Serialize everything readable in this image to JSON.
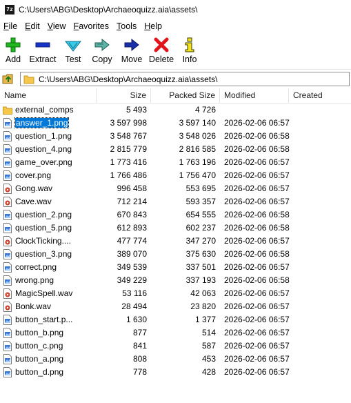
{
  "window": {
    "app_icon_text": "7z",
    "title": "C:\\Users\\ABG\\Desktop\\Archaeoquizz.aia\\assets\\"
  },
  "menu": [
    {
      "key": "F",
      "rest": "ile"
    },
    {
      "key": "E",
      "rest": "dit"
    },
    {
      "key": "V",
      "rest": "iew"
    },
    {
      "key": "",
      "pre": "F",
      "rest": "avorites",
      "underline_index": 0
    },
    {
      "key": "T",
      "rest": "ools"
    },
    {
      "key": "H",
      "rest": "elp"
    }
  ],
  "toolbar": {
    "add": "Add",
    "extract": "Extract",
    "test": "Test",
    "copy": "Copy",
    "move": "Move",
    "delete": "Delete",
    "info": "Info"
  },
  "address": {
    "path": "C:\\Users\\ABG\\Desktop\\Archaeoquizz.aia\\assets\\"
  },
  "columns": {
    "name": "Name",
    "size": "Size",
    "packed": "Packed Size",
    "modified": "Modified",
    "created": "Created"
  },
  "files": [
    {
      "name": "external_comps",
      "type": "folder",
      "size": "5 493",
      "packed": "4 726",
      "modified": ""
    },
    {
      "name": "answer_1.png",
      "type": "image",
      "size": "3 597 998",
      "packed": "3 597 140",
      "modified": "2026-02-06 06:57",
      "selected": true
    },
    {
      "name": "question_1.png",
      "type": "image",
      "size": "3 548 767",
      "packed": "3 548 026",
      "modified": "2026-02-06 06:58"
    },
    {
      "name": "question_4.png",
      "type": "image",
      "size": "2 815 779",
      "packed": "2 816 585",
      "modified": "2026-02-06 06:58"
    },
    {
      "name": "game_over.png",
      "type": "image",
      "size": "1 773 416",
      "packed": "1 763 196",
      "modified": "2026-02-06 06:57"
    },
    {
      "name": "cover.png",
      "type": "image",
      "size": "1 766 486",
      "packed": "1 756 470",
      "modified": "2026-02-06 06:57"
    },
    {
      "name": "Gong.wav",
      "type": "audio",
      "size": "996 458",
      "packed": "553 695",
      "modified": "2026-02-06 06:57"
    },
    {
      "name": "Cave.wav",
      "type": "audio",
      "size": "712 214",
      "packed": "593 357",
      "modified": "2026-02-06 06:57"
    },
    {
      "name": "question_2.png",
      "type": "image",
      "size": "670 843",
      "packed": "654 555",
      "modified": "2026-02-06 06:58"
    },
    {
      "name": "question_5.png",
      "type": "image",
      "size": "612 893",
      "packed": "602 237",
      "modified": "2026-02-06 06:58"
    },
    {
      "name": "ClockTicking....",
      "type": "audio",
      "size": "477 774",
      "packed": "347 270",
      "modified": "2026-02-06 06:57"
    },
    {
      "name": "question_3.png",
      "type": "image",
      "size": "389 070",
      "packed": "375 630",
      "modified": "2026-02-06 06:58"
    },
    {
      "name": "correct.png",
      "type": "image",
      "size": "349 539",
      "packed": "337 501",
      "modified": "2026-02-06 06:57"
    },
    {
      "name": "wrong.png",
      "type": "image",
      "size": "349 229",
      "packed": "337 193",
      "modified": "2026-02-06 06:58"
    },
    {
      "name": "MagicSpell.wav",
      "type": "audio",
      "size": "53 116",
      "packed": "42 063",
      "modified": "2026-02-06 06:57"
    },
    {
      "name": "Bonk.wav",
      "type": "audio",
      "size": "28 494",
      "packed": "23 820",
      "modified": "2026-02-06 06:57"
    },
    {
      "name": "button_start.p...",
      "type": "image",
      "size": "1 630",
      "packed": "1 377",
      "modified": "2026-02-06 06:57"
    },
    {
      "name": "button_b.png",
      "type": "image",
      "size": "877",
      "packed": "514",
      "modified": "2026-02-06 06:57"
    },
    {
      "name": "button_c.png",
      "type": "image",
      "size": "841",
      "packed": "587",
      "modified": "2026-02-06 06:57"
    },
    {
      "name": "button_a.png",
      "type": "image",
      "size": "808",
      "packed": "453",
      "modified": "2026-02-06 06:57"
    },
    {
      "name": "button_d.png",
      "type": "image",
      "size": "778",
      "packed": "428",
      "modified": "2026-02-06 06:57"
    }
  ]
}
